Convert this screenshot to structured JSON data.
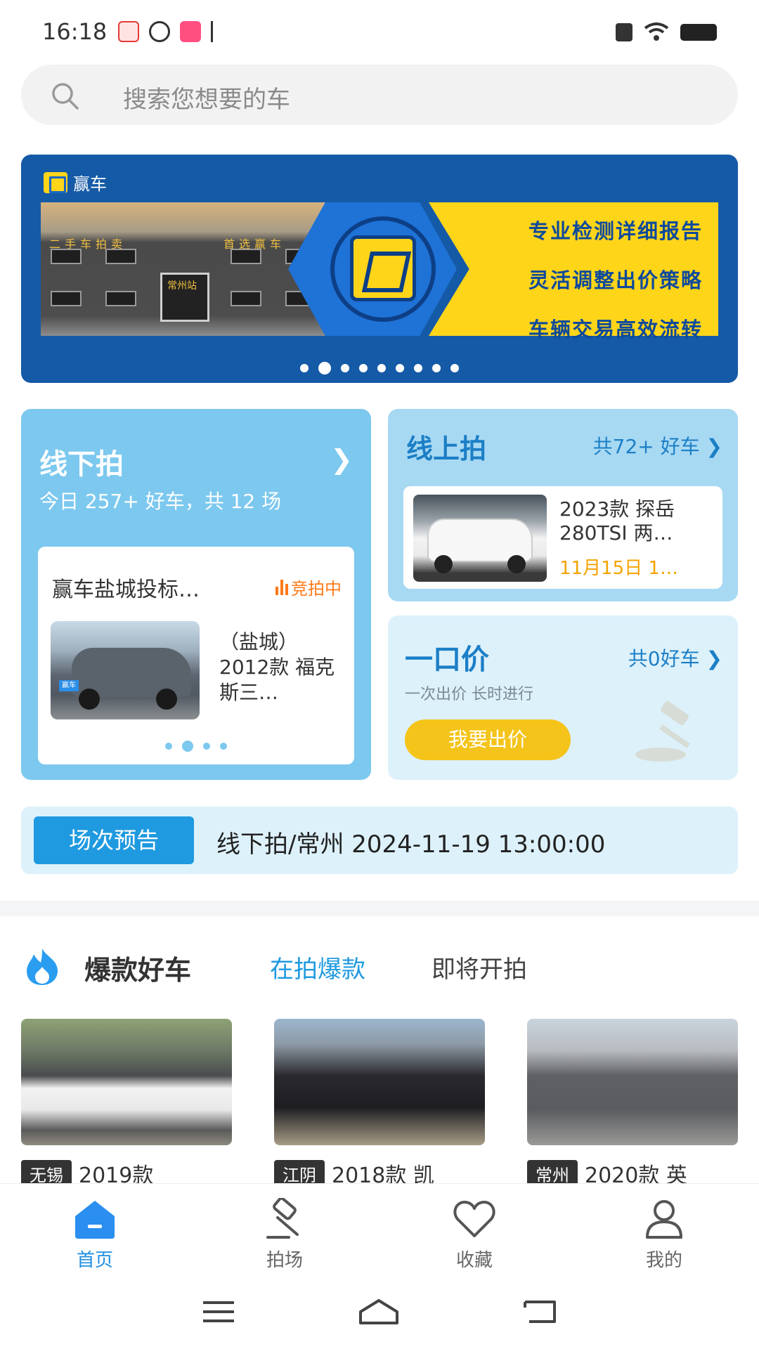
{
  "status_bar": {
    "time": "16:18"
  },
  "search": {
    "placeholder": "搜索您想要的车"
  },
  "banner": {
    "logo_text": "赢车",
    "photo_sign_left": "二手车拍卖",
    "photo_sign_right": "首选赢车",
    "photo_station": "常州站",
    "lines": [
      "专业检测详细报告",
      "灵活调整出价策略",
      "车辆交易高效流转"
    ],
    "dots_total": 9,
    "dots_active": 2
  },
  "offline": {
    "title": "线下拍",
    "subtitle": "今日 257+ 好车，共 12 场",
    "session_title": "赢车盐城投标…",
    "status": "竞拍中",
    "car_desc": "（盐城）2012款 福克斯三…",
    "photo_badge": "赢车"
  },
  "online": {
    "title": "线上拍",
    "count": "共72+ 好车",
    "car_desc_line1": "2023款 探岳",
    "car_desc_line2": "280TSI 两…",
    "date": "11月15日 1…"
  },
  "fixed_price": {
    "title": "一口价",
    "count": "共0好车",
    "subtitle": "一次出价  长时进行",
    "button": "我要出价"
  },
  "preview": {
    "tag": "场次预告",
    "text": "线下拍/常州 2024-11-19 13:00:00"
  },
  "hot": {
    "title": "爆款好车",
    "tab_active": "在拍爆款",
    "tab_inactive": "即将开拍",
    "items": [
      {
        "city": "无锡",
        "model": "2019款"
      },
      {
        "city": "江阴",
        "model": "2018款 凯"
      },
      {
        "city": "常州",
        "model": "2020款 英"
      }
    ]
  },
  "tabbar": {
    "items": [
      {
        "label": "首页",
        "icon": "home-icon"
      },
      {
        "label": "拍场",
        "icon": "gavel-icon"
      },
      {
        "label": "收藏",
        "icon": "heart-icon"
      },
      {
        "label": "我的",
        "icon": "user-icon"
      }
    ]
  },
  "colors": {
    "accent": "#1f9ae0",
    "offline_card": "#7cc8ef",
    "online_card": "#a8d9f3",
    "price_card": "#ddf1fb",
    "banner": "#155aa6",
    "yellow": "#ffd51a",
    "live": "#ff7a1a"
  }
}
